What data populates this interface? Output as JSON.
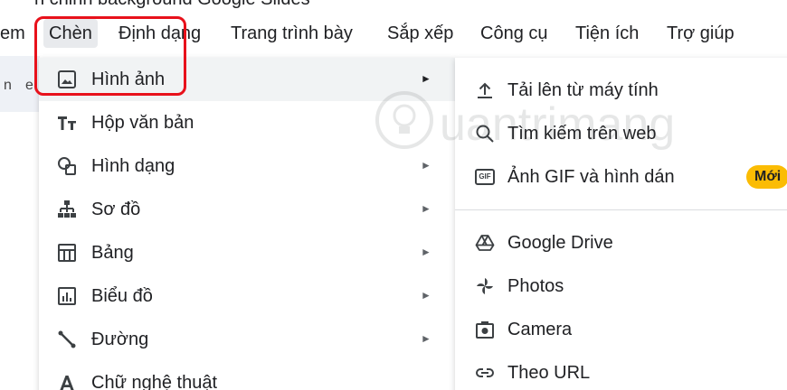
{
  "title_fragment": "n chỉnh background Google Slides",
  "menubar": {
    "items": [
      "em",
      "Chèn",
      "Định dạng",
      "Trang trình bày",
      "Sắp xếp",
      "Công cụ",
      "Tiện ích",
      "Trợ giúp"
    ],
    "active": "Chèn"
  },
  "toolbar_fragment": [
    "n",
    "e"
  ],
  "insert_menu": {
    "items": [
      {
        "label": "Hình ảnh",
        "icon": "image-icon",
        "has_submenu": true,
        "highlighted": true
      },
      {
        "label": "Hộp văn bản",
        "icon": "text-box-icon",
        "has_submenu": false
      },
      {
        "label": "Hình dạng",
        "icon": "shapes-icon",
        "has_submenu": true
      },
      {
        "label": "Sơ đồ",
        "icon": "diagram-icon",
        "has_submenu": true
      },
      {
        "label": "Bảng",
        "icon": "table-icon",
        "has_submenu": true
      },
      {
        "label": "Biểu đồ",
        "icon": "chart-icon",
        "has_submenu": true
      },
      {
        "label": "Đường",
        "icon": "line-icon",
        "has_submenu": true
      },
      {
        "label": "Chữ nghệ thuật",
        "icon": "word-art-icon",
        "has_submenu": false
      }
    ],
    "submenu_arrow": "►"
  },
  "image_submenu": {
    "items": [
      {
        "label": "Tải lên từ máy tính",
        "icon": "upload-icon"
      },
      {
        "label": "Tìm kiếm trên web",
        "icon": "search-icon"
      },
      {
        "label": "Ảnh GIF và hình dán",
        "icon": "gif-icon",
        "icon_text": "GIF",
        "badge": "Mới"
      },
      {
        "label": "Google Drive",
        "icon": "google-drive-icon"
      },
      {
        "label": "Photos",
        "icon": "google-photos-icon"
      },
      {
        "label": "Camera",
        "icon": "camera-icon"
      },
      {
        "label": "Theo URL",
        "icon": "link-icon"
      }
    ]
  },
  "watermark": "uantrimang",
  "colors": {
    "highlight_border": "#e8111b",
    "badge_bg": "#fbbc04",
    "menu_hover": "#f1f3f4",
    "active_menu_bg": "#e8eaed"
  }
}
